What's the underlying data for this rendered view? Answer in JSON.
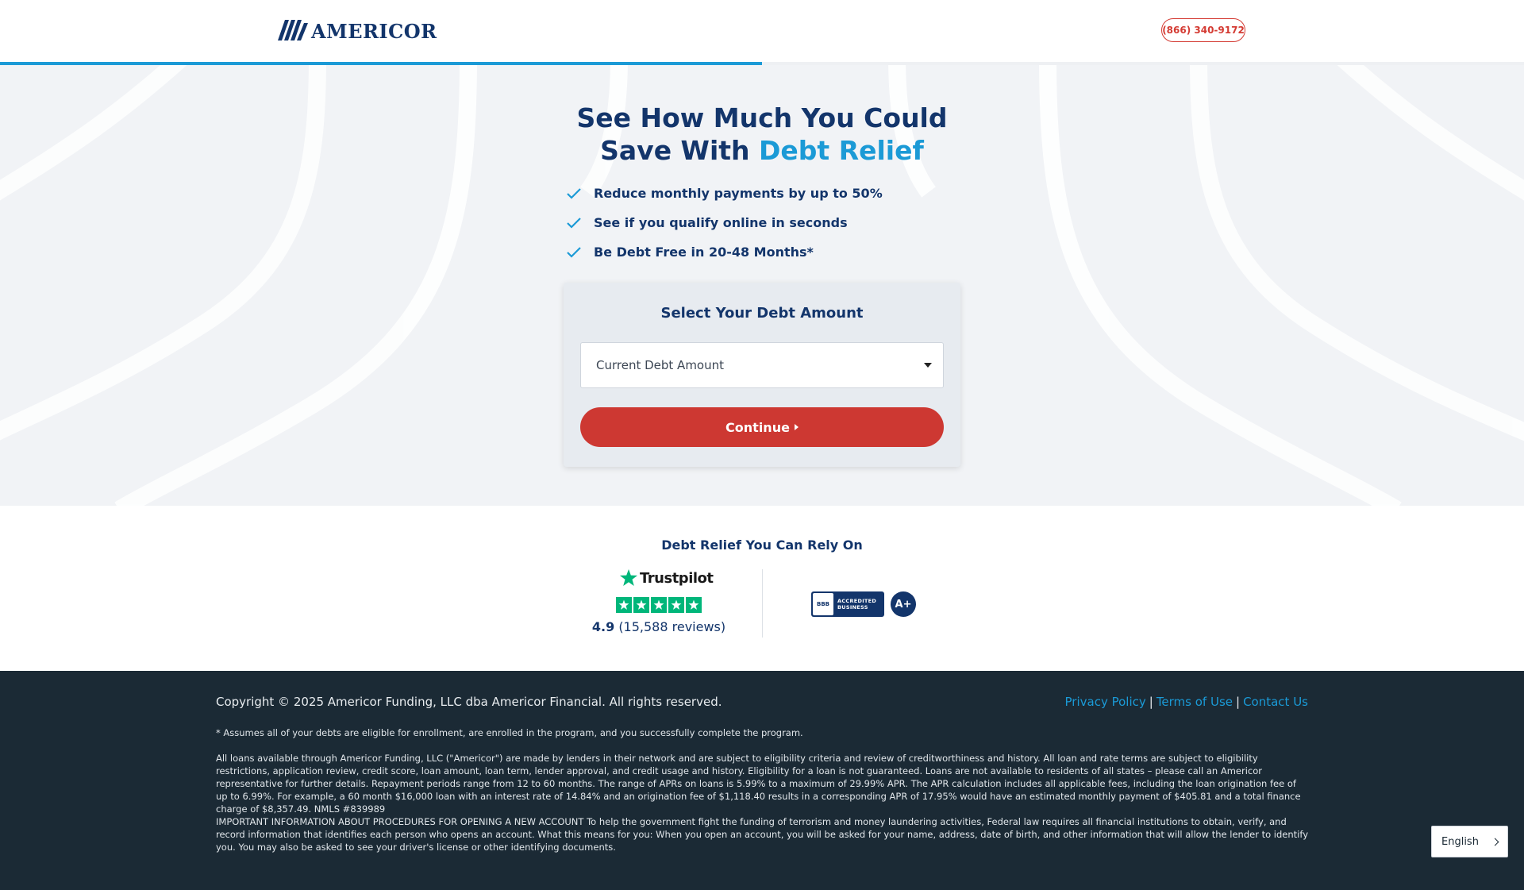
{
  "header": {
    "logo_text": "AMERICOR",
    "phone": "(866) 340-9172",
    "progress": 0.5
  },
  "hero": {
    "headline_line1": "See How Much You Could",
    "headline_line2_prefix": "Save With ",
    "headline_line2_accent": "Debt Relief",
    "bullets": [
      "Reduce monthly payments by up to 50%",
      "See if you qualify online in seconds",
      "Be Debt Free in 20-48 Months*"
    ]
  },
  "form": {
    "title": "Select Your Debt Amount",
    "select_placeholder": "Current Debt Amount",
    "continue_label": "Continue"
  },
  "trust": {
    "title": "Debt Relief You Can Rely On",
    "trustpilot_name": "Trustpilot",
    "rating": "4.9",
    "reviews": "(15,588 reviews)",
    "bbb_line1": "ACCREDITED",
    "bbb_line2": "BUSINESS",
    "bbb_seal": "BBB",
    "bbb_grade": "A+"
  },
  "footer": {
    "copyright": "Copyright © 2025 Americor Funding, LLC dba Americor Financial. All rights reserved.",
    "links": [
      "Privacy Policy",
      "Terms of Use",
      "Contact Us"
    ],
    "disclaimer1": "* Assumes all of your debts are eligible for enrollment, are enrolled in the program, and you successfully complete the program.",
    "disclaimer2": "All loans available through Americor Funding, LLC (\"Americor\") are made by lenders in their network and are subject to eligibility criteria and review of creditworthiness and history. All loan and rate terms are subject to eligibility restrictions, application review, credit score, loan amount, loan term, lender approval, and credit usage and history. Eligibility for a loan is not guaranteed. Loans are not available to residents of all states – please call an Americor representative for further details. Repayment periods range from 12 to 60 months. The range of APRs on loans is 5.99% to a maximum of 29.99% APR. The APR calculation includes all applicable fees, including the loan origination fee of up to 6.99%. For example, a 60 month $16,000 loan with an interest rate of 14.84% and an origination fee of $1,118.40 results in a corresponding APR of 17.95% would have an estimated monthly payment of $405.81 and a total finance charge of $8,357.49. NMLS #839989",
    "disclaimer3": "IMPORTANT INFORMATION ABOUT PROCEDURES FOR OPENING A NEW ACCOUNT To help the government fight the funding of terrorism and money laundering activities, Federal law requires all financial institutions to obtain, verify, and record information that identifies each person who opens an account. What this means for you: When you open an account, you will be asked for your name, address, date of birth, and other information that will allow the lender to identify you. You may also be asked to see your driver's license or other identifying documents."
  },
  "language": {
    "current": "English"
  },
  "colors": {
    "navy": "#13356b",
    "accent_blue": "#1b9ad6",
    "cta_red": "#cd3832",
    "footer_bg": "#1b2a35",
    "trustpilot_green": "#00b67a"
  }
}
